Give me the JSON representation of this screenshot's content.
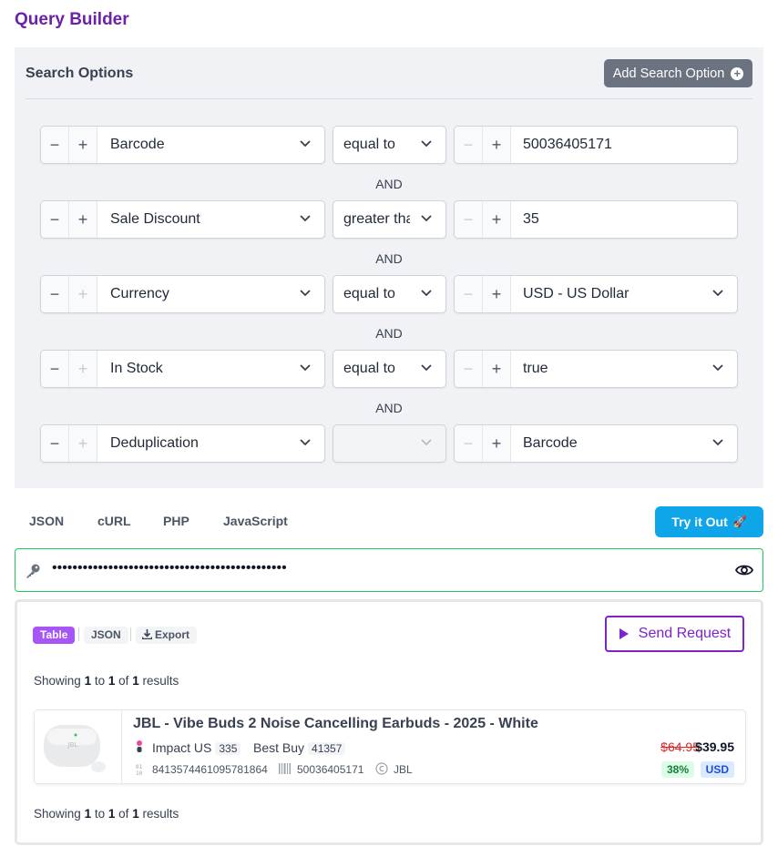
{
  "title": "Query Builder",
  "search_options": {
    "title": "Search Options",
    "add_label": "Add Search Option",
    "connector": "AND",
    "rows": [
      {
        "field": "Barcode",
        "operator": "equal to",
        "value": "50036405171"
      },
      {
        "field": "Sale Discount",
        "operator": "greater than",
        "value": "35"
      },
      {
        "field": "Currency",
        "operator": "equal to",
        "value": "USD - US Dollar"
      },
      {
        "field": "In Stock",
        "operator": "equal to",
        "value": "true"
      },
      {
        "field": "Deduplication",
        "operator": "",
        "value": "Barcode"
      }
    ]
  },
  "code_tabs": [
    "JSON",
    "cURL",
    "PHP",
    "JavaScript"
  ],
  "try_label": "Try it Out",
  "try_icon": "🚀",
  "api_key_masked": "••••••••••••••••••••••••••••••••••••••••••••••",
  "result": {
    "view_tabs": [
      "Table",
      "JSON",
      "Export"
    ],
    "send_label": "Send Request",
    "showing": {
      "prefix": "Showing",
      "from": "1",
      "to_word": "to",
      "to": "1",
      "of_word": "of",
      "total": "1",
      "suffix": "results"
    },
    "product": {
      "name": "JBL - Vibe Buds 2 Noise Cancelling Earbuds - 2025 - White",
      "stores": [
        {
          "name": "Impact US",
          "count": "335"
        },
        {
          "name": "Best Buy",
          "count": "41357"
        }
      ],
      "id_code": "8413574461095781864",
      "barcode": "50036405171",
      "brand": "JBL",
      "old_price": "$64.95",
      "new_price": "$39.95",
      "discount": "38%",
      "currency": "USD"
    }
  },
  "colors": {
    "brand_purple": "#6b21a8",
    "try_blue": "#0ea5e9",
    "key_border": "#22c55e",
    "table_pill": "#a855f7"
  }
}
